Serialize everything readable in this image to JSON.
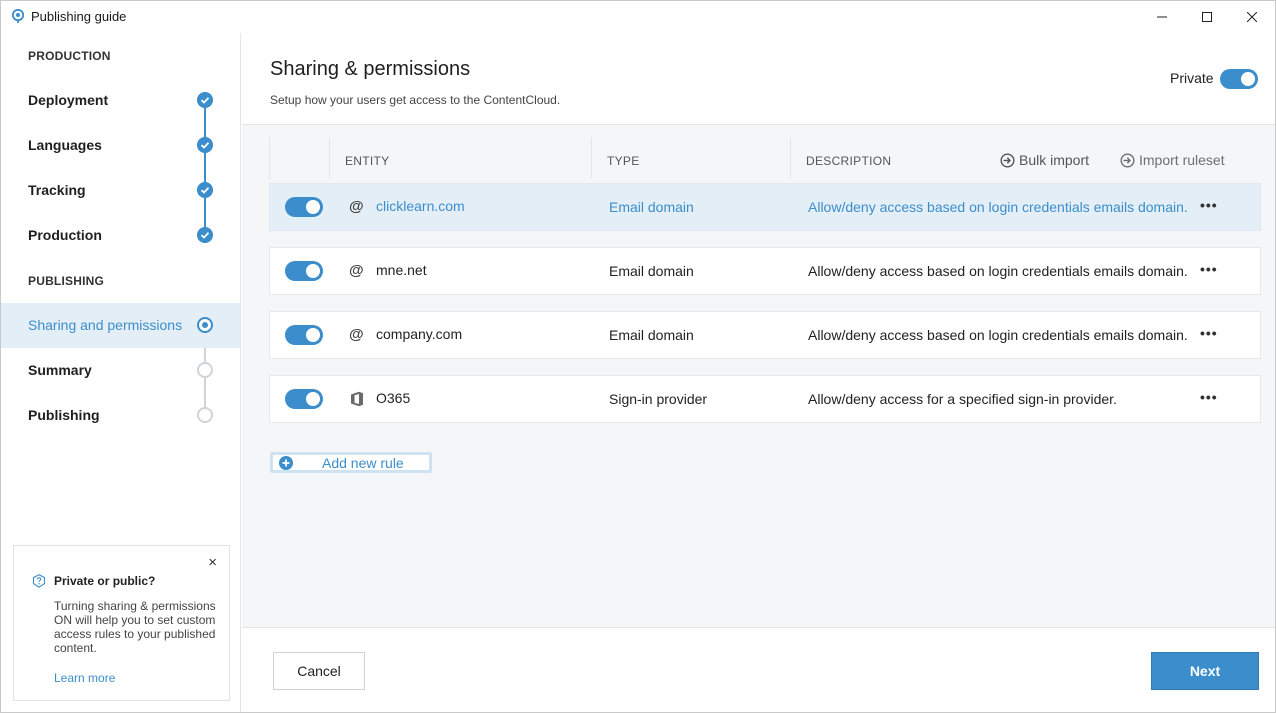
{
  "window": {
    "title": "Publishing guide"
  },
  "sidebar": {
    "sections": [
      {
        "label": "PRODUCTION",
        "steps": [
          {
            "label": "Deployment",
            "state": "done"
          },
          {
            "label": "Languages",
            "state": "done"
          },
          {
            "label": "Tracking",
            "state": "done"
          },
          {
            "label": "Production",
            "state": "done"
          }
        ]
      },
      {
        "label": "PUBLISHING",
        "steps": [
          {
            "label": "Sharing and permissions",
            "state": "current"
          },
          {
            "label": "Summary",
            "state": "todo"
          },
          {
            "label": "Publishing",
            "state": "todo"
          }
        ]
      }
    ],
    "tip": {
      "title": "Private or public?",
      "body": "Turning sharing & permissions ON will help you to set custom access rules to your published content.",
      "link": "Learn more",
      "close_symbol": "×"
    }
  },
  "main": {
    "title": "Sharing & permissions",
    "subtitle": "Setup how your users get access to the ContentCloud.",
    "private_label": "Private",
    "private_on": true,
    "columns": {
      "entity": "ENTITY",
      "type": "TYPE",
      "description": "DESCRIPTION"
    },
    "actions": {
      "bulk_import": "Bulk import",
      "import_ruleset": "Import ruleset"
    },
    "rules": [
      {
        "enabled": true,
        "icon": "at-icon",
        "entity": "clicklearn.com",
        "type": "Email domain",
        "description": "Allow/deny access based on login credentials emails domain.",
        "selected": true
      },
      {
        "enabled": true,
        "icon": "at-icon",
        "entity": "mne.net",
        "type": "Email domain",
        "description": "Allow/deny access based on login credentials emails domain.",
        "selected": false
      },
      {
        "enabled": true,
        "icon": "at-icon",
        "entity": "company.com",
        "type": "Email domain",
        "description": "Allow/deny access based on login credentials emails domain.",
        "selected": false
      },
      {
        "enabled": true,
        "icon": "office-icon",
        "entity": "O365",
        "type": "Sign-in provider",
        "description": "Allow/deny access for a specified sign-in provider.",
        "selected": false
      }
    ],
    "more_symbol": "•••",
    "add_rule_label": "Add new rule"
  },
  "footer": {
    "cancel_label": "Cancel",
    "next_label": "Next"
  },
  "colors": {
    "accent": "#3b8ecb",
    "selected_row": "#e4eef7",
    "inactive_step": "#cfd4da"
  }
}
